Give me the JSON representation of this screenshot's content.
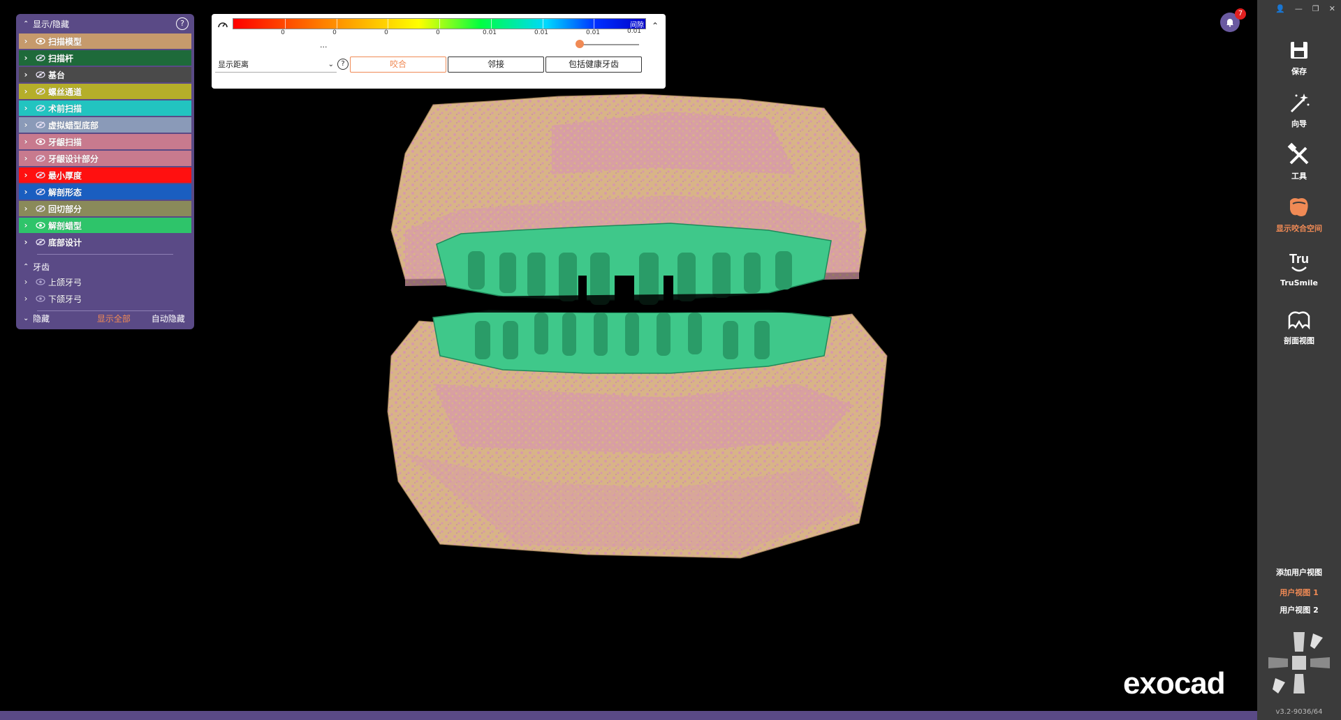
{
  "left_panel": {
    "title": "显示/隐藏",
    "help": "?",
    "layers": [
      {
        "label": "扫描模型",
        "color": "#c69a6c",
        "visible": true
      },
      {
        "label": "扫描杆",
        "color": "#1e6a3a",
        "visible": false
      },
      {
        "label": "基台",
        "color": "#4a4a4a",
        "visible": false
      },
      {
        "label": "螺丝通道",
        "color": "#b5ae2a",
        "visible": false
      },
      {
        "label": "术前扫描",
        "color": "#22c4c0",
        "visible": false
      },
      {
        "label": "虚拟蜡型底部",
        "color": "#8a9ab8",
        "visible": false
      },
      {
        "label": "牙龈扫描",
        "color": "#c87a8e",
        "visible": true
      },
      {
        "label": "牙龈设计部分",
        "color": "#c87a8e",
        "visible": false
      },
      {
        "label": "最小厚度",
        "color": "#ff1010",
        "visible": false
      },
      {
        "label": "解剖形态",
        "color": "#1a5ec0",
        "visible": false
      },
      {
        "label": "回切部分",
        "color": "#8a8a5a",
        "visible": false
      },
      {
        "label": "解剖蜡型",
        "color": "#2ec46a",
        "visible": true
      },
      {
        "label": "底部设计",
        "color": "#5a4a86",
        "visible": false
      }
    ],
    "teeth_section": "牙齿",
    "teeth": [
      {
        "label": "上颌牙弓"
      },
      {
        "label": "下颌牙弓"
      }
    ],
    "footer": {
      "hide": "隐藏",
      "show_all": "显示全部",
      "auto_hide": "自动隐藏"
    }
  },
  "distance_panel": {
    "gap_label": "间隙",
    "ticks": [
      "0",
      "0",
      "0",
      "0",
      "0.01",
      "0.01",
      "0.01",
      "0.01"
    ],
    "ellipsis": "...",
    "select_value": "显示距离",
    "help": "?",
    "tabs": [
      "咬合",
      "邻接",
      "包括健康牙齿"
    ],
    "active_tab": 0,
    "collapse": "^"
  },
  "notification": {
    "count": "7"
  },
  "logo": "exocad",
  "toolbar": {
    "window_controls": [
      "👤",
      "—",
      "❐",
      "✕"
    ],
    "tools": [
      {
        "label": "保存",
        "icon": "save-icon"
      },
      {
        "label": "向导",
        "icon": "wizard-icon"
      },
      {
        "label": "工具",
        "icon": "tools-icon"
      },
      {
        "label": "显示咬合空间",
        "icon": "occlusion-space-icon",
        "active": true
      },
      {
        "label": "TruSmile",
        "icon": "trusmile-icon"
      },
      {
        "label": "剖面视图",
        "icon": "section-view-icon"
      }
    ],
    "trusmile_logo": "Tru",
    "add_view": "添加用户视图",
    "views": [
      {
        "label": "用户视图 1",
        "active": true
      },
      {
        "label": "用户视图 2",
        "active": false
      }
    ],
    "version": "v3.2-9036/64"
  },
  "colors": {
    "accent": "#f08a55",
    "panel": "#5a4a86",
    "teeth": "#3fc88a",
    "model_tan": "#d8b487",
    "gingiva_pink": "#d89aaa"
  }
}
